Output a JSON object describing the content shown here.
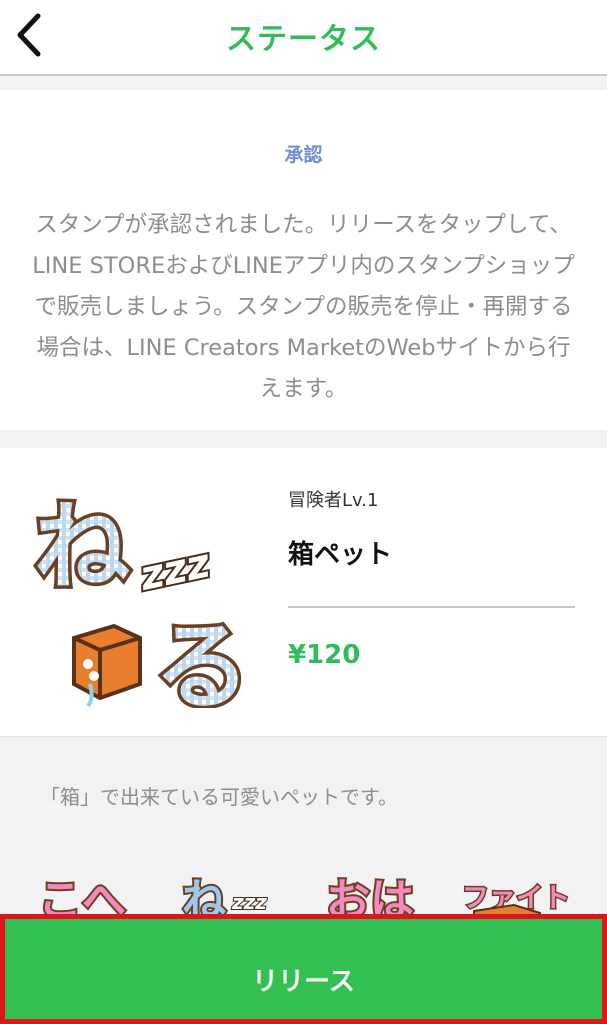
{
  "nav": {
    "title": "ステータス",
    "back_icon": "chevron-left-icon"
  },
  "status": {
    "label": "承認",
    "message": "スタンプが承認されました。リリースをタップして、LINE STOREおよびLINEアプリ内のスタンプショップで販売しましょう。スタンプの販売を停止・再開する場合は、LINE Creators MarketのWebサイトから行えます。"
  },
  "product": {
    "creator": "冒険者Lv.1",
    "name": "箱ペット",
    "price": "¥120",
    "sticker": {
      "text_top": "ね",
      "text_bottom": "る",
      "zzz": "zzz"
    }
  },
  "description": "「箱」で出来ている可愛いペットです。",
  "previews": [
    {
      "text": "こへ",
      "color": "#f28ac0"
    },
    {
      "text": "ね",
      "color": "#9bc9ee"
    },
    {
      "text": "おは",
      "color": "#f28ac0"
    },
    {
      "text": "ファイト",
      "color": "#f28ac0"
    }
  ],
  "release_button": {
    "label": "リリース"
  },
  "colors": {
    "accent_green": "#2fbd57",
    "status_blue": "#6e8fd6",
    "highlight_red": "#e0141c"
  }
}
